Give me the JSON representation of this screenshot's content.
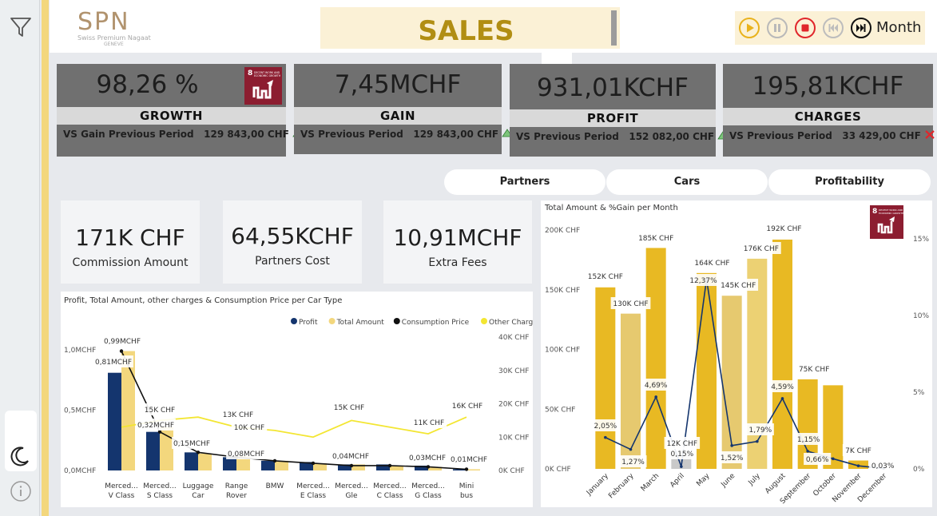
{
  "header": {
    "brand": "SPN",
    "brand_sub1": "Swiss Premium Nagaat",
    "brand_sub2": "GENEVE",
    "title": "SALES",
    "player_label": "Month"
  },
  "kpis": [
    {
      "value": "98,26 %",
      "label": "GROWTH",
      "compare_label": "VS Gain Previous Period",
      "compare_value": "129 843,00 CHF",
      "trend": "up",
      "badge": "8 DECENT WORK AND ECONOMIC GROWTH"
    },
    {
      "value": "7,45MCHF",
      "label": "GAIN",
      "compare_label": "VS Previous Period",
      "compare_value": "129 843,00 CHF",
      "trend": "up"
    },
    {
      "value": "931,01KCHF",
      "label": "PROFIT",
      "compare_label": "VS Previous Period",
      "compare_value": "152 082,00 CHF",
      "trend": "up"
    },
    {
      "value": "195,81KCHF",
      "label": "CHARGES",
      "compare_label": "VS Previous Period",
      "compare_value": "33 429,00 CHF",
      "trend": "down"
    }
  ],
  "tabs": [
    "Partners",
    "Cars",
    "Profitability"
  ],
  "cards": [
    {
      "value": "171K CHF",
      "label": "Commission Amount"
    },
    {
      "value": "64,55KCHF",
      "label": "Partners Cost"
    },
    {
      "value": "10,91MCHF",
      "label": "Extra Fees"
    }
  ],
  "colors": {
    "gold": "#e8b923",
    "gold_light": "#f3d77d",
    "navy": "#14356e",
    "yellow_line": "#f3e632",
    "sdg_red": "#8c1d30"
  },
  "chart_data": [
    {
      "type": "bar",
      "title": "Profit, Total Amount, other charges & Consumption Price per Car Type",
      "legend": [
        "Profit",
        "Total Amount",
        "Consumption Price",
        "Other Charges"
      ],
      "legend_position": "top-right",
      "categories": [
        "Merced... V Class",
        "Merced... S Class",
        "Luggage Car",
        "Range Rover",
        "BMW",
        "Merced... E Class",
        "Merced... Gle",
        "Merced... C Class",
        "Merced... G Class",
        "Mini bus"
      ],
      "y_ticks": [
        "1,0MCHF",
        "0,5MCHF",
        "0,0MCHF"
      ],
      "y2_ticks": [
        "40K CHF",
        "30K CHF",
        "20K CHF",
        "10K CHF",
        "0K CHF"
      ],
      "ylim": [
        0,
        1.0
      ],
      "y2lim": [
        0,
        40
      ],
      "series": [
        {
          "name": "Profit",
          "values": [
            0.81,
            0.32,
            0.15,
            0.11,
            0.08,
            0.07,
            0.05,
            0.05,
            0.04,
            0.01
          ]
        },
        {
          "name": "Total Amount",
          "values": [
            0.99,
            0.36,
            0.14,
            0.12,
            0.08,
            0.06,
            0.05,
            0.04,
            0.03,
            0.01
          ]
        },
        {
          "name": "Consumption Price",
          "values": [
            0.99,
            0.32,
            0.15,
            0.11,
            0.08,
            0.06,
            0.04,
            0.04,
            0.03,
            0.01
          ]
        },
        {
          "name": "Other Charges",
          "values": [
            13,
            15,
            16,
            13,
            12,
            10,
            15,
            13,
            11,
            16
          ]
        }
      ],
      "data_labels": [
        "0,99MCHF",
        "0,81MCHF",
        "15K CHF",
        "0,32MCHF",
        "0,15MCHF",
        "13K CHF",
        "0,08MCHF",
        "10K CHF",
        "15K CHF",
        "0,04MCHF",
        "11K CHF",
        "0,03MCHF",
        "16K CHF",
        "0,01MCHF"
      ]
    },
    {
      "type": "bar",
      "title": "Total Amount & %Gain per Month",
      "categories": [
        "January",
        "February",
        "March",
        "April",
        "May",
        "June",
        "July",
        "August",
        "September",
        "October",
        "November",
        "December"
      ],
      "y_ticks": [
        "200K CHF",
        "150K CHF",
        "100K CHF",
        "50K CHF",
        "0K CHF"
      ],
      "y2_ticks": [
        "15%",
        "10%",
        "5%",
        "0%"
      ],
      "ylim": [
        0,
        200
      ],
      "y2lim": [
        0,
        15
      ],
      "series": [
        {
          "name": "Total Amount",
          "values": [
            152,
            130,
            185,
            12,
            164,
            145,
            176,
            192,
            75,
            70,
            7,
            0
          ]
        },
        {
          "name": "%Gain",
          "values": [
            2.05,
            1.27,
            4.69,
            0.15,
            12.37,
            1.52,
            1.79,
            4.59,
            1.15,
            0.66,
            0.2,
            0.03
          ]
        }
      ],
      "bar_labels": [
        "152K CHF",
        "130K CHF",
        "185K CHF",
        "12K CHF",
        "164K CHF",
        "145K CHF",
        "176K CHF",
        "192K CHF",
        "75K CHF",
        "",
        "7K CHF",
        ""
      ],
      "pct_labels": [
        "2,05%",
        "1,27%",
        "4,69%",
        "0,15%",
        "12,37%",
        "1,52%",
        "1,79%",
        "4,59%",
        "1,15%",
        "0,66%",
        "",
        "0,03%"
      ],
      "badge": "8 DECENT WORK AND ECONOMIC GROWTH"
    }
  ]
}
